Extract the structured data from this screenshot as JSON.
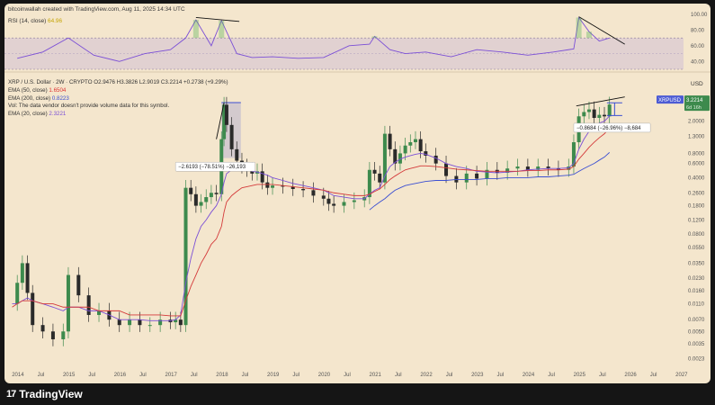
{
  "header": {
    "credit": "bitcoinwallah created with TradingView.com, Aug 11, 2025 14:34 UTC"
  },
  "rsi_legend": {
    "name": "RSI (14, close)",
    "value": "64.96",
    "value_color": "#c4a400"
  },
  "main_legend": {
    "symbol": "XRP / U.S. Dollar · 2W · CRYPTO",
    "ohlc": "O2.9476 H3.3826 L2.9019 C3.2214 +0.2738 (+9.29%)",
    "ema50_name": "EMA (50, close)",
    "ema50_value": "1.6504",
    "ema200_name": "EMA (200, close)",
    "ema200_value": "0.8223",
    "vol_note": "Vol: The data vendor doesn't provide volume data for this symbol.",
    "ema20_name": "EMA (20, close)",
    "ema20_value": "2.3221"
  },
  "footer": {
    "logo": "TradingView",
    "logo_mark": "17"
  },
  "annotations": {
    "drop_2018": "−2.6193 (−78.51%) −26,193",
    "drop_2025": "−0.8684 (−26.96%) −8,684",
    "price_tag_symbol": "XRPUSD",
    "price_tag_value": "3.2214",
    "price_tag_time": "6d 16h",
    "usd_label": "USD"
  },
  "colors": {
    "background": "#f4e6cd",
    "up": "#3d8a4d",
    "down": "#2a2a2a",
    "ema20": "#d43a3a",
    "ema50": "#d43a3a",
    "ema200": "#3b4fd2",
    "rsi": "#7b4fd6",
    "rsi_ma": "#c4a400",
    "highlight": "#3b4fd2"
  },
  "chart_data": [
    {
      "type": "line",
      "title": "RSI (14, close)",
      "y_ticks": [
        "100.00",
        "80.00",
        "60.00",
        "40.00"
      ],
      "ylim": [
        30,
        100
      ],
      "band": [
        30,
        70
      ],
      "x": [
        2014.0,
        2014.5,
        2015.0,
        2015.5,
        2016.0,
        2016.5,
        2017.0,
        2017.3,
        2017.5,
        2017.8,
        2018.0,
        2018.3,
        2018.6,
        2019.0,
        2019.5,
        2020.0,
        2020.5,
        2020.9,
        2021.0,
        2021.3,
        2021.6,
        2022.0,
        2022.5,
        2023.0,
        2023.5,
        2024.0,
        2024.5,
        2024.9,
        2025.0,
        2025.2,
        2025.4,
        2025.6
      ],
      "series": [
        {
          "name": "RSI",
          "values": [
            44,
            52,
            70,
            48,
            40,
            50,
            55,
            70,
            93,
            60,
            92,
            50,
            45,
            46,
            44,
            45,
            60,
            62,
            72,
            55,
            50,
            52,
            46,
            55,
            52,
            48,
            52,
            56,
            96,
            78,
            66,
            70
          ]
        }
      ]
    },
    {
      "type": "candlestick",
      "title": "XRP / U.S. Dollar · 2W · CRYPTO",
      "scale": "log",
      "ylabel": "USD",
      "x_ticks": [
        "2014",
        "Jul",
        "2015",
        "Jul",
        "2016",
        "Jul",
        "2017",
        "Jul",
        "2018",
        "Jul",
        "2019",
        "Jul",
        "2020",
        "Jul",
        "2021",
        "Jul",
        "2022",
        "Jul",
        "2023",
        "Jul",
        "2024",
        "Jul",
        "2025",
        "Jul",
        "2026",
        "Jul",
        "2027"
      ],
      "x_tick_years": [
        2014.0,
        2014.5,
        2015.0,
        2015.5,
        2016.0,
        2016.5,
        2017.0,
        2017.5,
        2018.0,
        2018.5,
        2019.0,
        2019.5,
        2020.0,
        2020.5,
        2021.0,
        2021.5,
        2022.0,
        2022.5,
        2023.0,
        2023.5,
        2024.0,
        2024.5,
        2025.0,
        2025.5,
        2026.0,
        2026.5,
        2027.0
      ],
      "y_ticks": [
        "3.0000",
        "2.0000",
        "1.3000",
        "0.8000",
        "0.6000",
        "0.4000",
        "0.2600",
        "0.1800",
        "0.1200",
        "0.0800",
        "0.0550",
        "0.0350",
        "0.0230",
        "0.0160",
        "0.0110",
        "0.0070",
        "0.0050",
        "0.0035",
        "0.0023"
      ],
      "y_tick_values": [
        3.0,
        2.0,
        1.3,
        0.8,
        0.6,
        0.4,
        0.26,
        0.18,
        0.12,
        0.08,
        0.055,
        0.035,
        0.023,
        0.016,
        0.011,
        0.007,
        0.005,
        0.0035,
        0.0023
      ],
      "ylim": [
        0.002,
        5.0
      ],
      "x": [
        2013.9,
        2014.0,
        2014.1,
        2014.2,
        2014.3,
        2014.5,
        2014.7,
        2014.9,
        2015.0,
        2015.2,
        2015.4,
        2015.6,
        2015.8,
        2016.0,
        2016.2,
        2016.4,
        2016.6,
        2016.8,
        2017.0,
        2017.1,
        2017.2,
        2017.3,
        2017.4,
        2017.5,
        2017.6,
        2017.7,
        2017.8,
        2017.9,
        2018.0,
        2018.05,
        2018.1,
        2018.2,
        2018.3,
        2018.4,
        2018.5,
        2018.6,
        2018.7,
        2018.8,
        2018.9,
        2019.0,
        2019.2,
        2019.4,
        2019.6,
        2019.8,
        2020.0,
        2020.1,
        2020.2,
        2020.4,
        2020.6,
        2020.8,
        2020.9,
        2021.0,
        2021.1,
        2021.2,
        2021.3,
        2021.4,
        2021.5,
        2021.6,
        2021.7,
        2021.8,
        2021.9,
        2022.0,
        2022.2,
        2022.4,
        2022.6,
        2022.8,
        2023.0,
        2023.2,
        2023.4,
        2023.6,
        2023.8,
        2024.0,
        2024.2,
        2024.4,
        2024.6,
        2024.8,
        2024.9,
        2025.0,
        2025.1,
        2025.2,
        2025.3,
        2025.4,
        2025.5,
        2025.6
      ],
      "series": [
        {
          "name": "XRP close",
          "values": [
            0.011,
            0.02,
            0.035,
            0.015,
            0.006,
            0.005,
            0.004,
            0.005,
            0.025,
            0.014,
            0.008,
            0.009,
            0.007,
            0.006,
            0.007,
            0.006,
            0.006,
            0.007,
            0.0065,
            0.007,
            0.006,
            0.3,
            0.25,
            0.18,
            0.2,
            0.23,
            0.26,
            0.25,
            1.2,
            3.2,
            1.8,
            0.9,
            0.65,
            0.55,
            0.5,
            0.45,
            0.48,
            0.35,
            0.3,
            0.32,
            0.31,
            0.29,
            0.28,
            0.24,
            0.22,
            0.19,
            0.18,
            0.2,
            0.21,
            0.23,
            0.5,
            0.45,
            0.35,
            1.4,
            0.9,
            0.6,
            0.8,
            1.0,
            1.1,
            1.2,
            0.85,
            0.75,
            0.6,
            0.42,
            0.35,
            0.45,
            0.39,
            0.5,
            0.46,
            0.52,
            0.55,
            0.5,
            0.55,
            0.52,
            0.5,
            0.55,
            1.1,
            2.3,
            2.6,
            2.8,
            2.2,
            2.4,
            2.3,
            3.2214
          ]
        },
        {
          "name": "EMA (20, close)",
          "values": [
            0.011,
            0.011,
            0.012,
            0.013,
            0.012,
            0.011,
            0.01,
            0.009,
            0.01,
            0.01,
            0.009,
            0.009,
            0.008,
            0.007,
            0.007,
            0.007,
            0.0068,
            0.0068,
            0.0068,
            0.007,
            0.008,
            0.02,
            0.04,
            0.07,
            0.1,
            0.12,
            0.15,
            0.18,
            0.25,
            0.35,
            0.45,
            0.5,
            0.52,
            0.52,
            0.5,
            0.48,
            0.47,
            0.45,
            0.43,
            0.4,
            0.37,
            0.34,
            0.32,
            0.3,
            0.28,
            0.26,
            0.24,
            0.23,
            0.22,
            0.22,
            0.25,
            0.28,
            0.3,
            0.42,
            0.55,
            0.62,
            0.68,
            0.72,
            0.75,
            0.78,
            0.8,
            0.78,
            0.7,
            0.6,
            0.55,
            0.52,
            0.48,
            0.47,
            0.46,
            0.47,
            0.48,
            0.5,
            0.51,
            0.52,
            0.52,
            0.53,
            0.6,
            0.9,
            1.2,
            1.5,
            1.7,
            1.9,
            2.0,
            2.3221
          ]
        },
        {
          "name": "EMA (50, close)",
          "values": [
            0.01,
            0.011,
            0.012,
            0.012,
            0.012,
            0.011,
            0.011,
            0.01,
            0.01,
            0.01,
            0.01,
            0.009,
            0.009,
            0.009,
            0.008,
            0.008,
            0.008,
            0.008,
            0.0078,
            0.0078,
            0.0078,
            0.012,
            0.018,
            0.025,
            0.035,
            0.045,
            0.06,
            0.07,
            0.1,
            0.15,
            0.2,
            0.24,
            0.27,
            0.3,
            0.31,
            0.32,
            0.33,
            0.33,
            0.33,
            0.33,
            0.32,
            0.31,
            0.3,
            0.29,
            0.28,
            0.27,
            0.26,
            0.25,
            0.24,
            0.24,
            0.25,
            0.27,
            0.29,
            0.33,
            0.38,
            0.42,
            0.46,
            0.5,
            0.52,
            0.54,
            0.56,
            0.56,
            0.55,
            0.53,
            0.51,
            0.5,
            0.49,
            0.48,
            0.48,
            0.48,
            0.48,
            0.49,
            0.49,
            0.5,
            0.5,
            0.51,
            0.55,
            0.68,
            0.8,
            0.95,
            1.1,
            1.25,
            1.4,
            1.6504
          ]
        },
        {
          "name": "EMA (200, close)",
          "values": [
            null,
            null,
            null,
            null,
            null,
            null,
            null,
            null,
            null,
            null,
            null,
            null,
            null,
            null,
            null,
            null,
            null,
            null,
            null,
            null,
            null,
            null,
            null,
            null,
            null,
            null,
            null,
            null,
            null,
            null,
            null,
            null,
            null,
            null,
            null,
            null,
            null,
            null,
            null,
            null,
            null,
            null,
            null,
            null,
            null,
            null,
            null,
            null,
            null,
            null,
            0.16,
            0.18,
            0.2,
            0.22,
            0.25,
            0.28,
            0.3,
            0.32,
            0.33,
            0.34,
            0.35,
            0.36,
            0.37,
            0.37,
            0.38,
            0.38,
            0.38,
            0.39,
            0.39,
            0.4,
            0.4,
            0.4,
            0.41,
            0.41,
            0.42,
            0.43,
            0.44,
            0.48,
            0.52,
            0.56,
            0.6,
            0.66,
            0.72,
            0.8223
          ]
        }
      ]
    }
  ]
}
